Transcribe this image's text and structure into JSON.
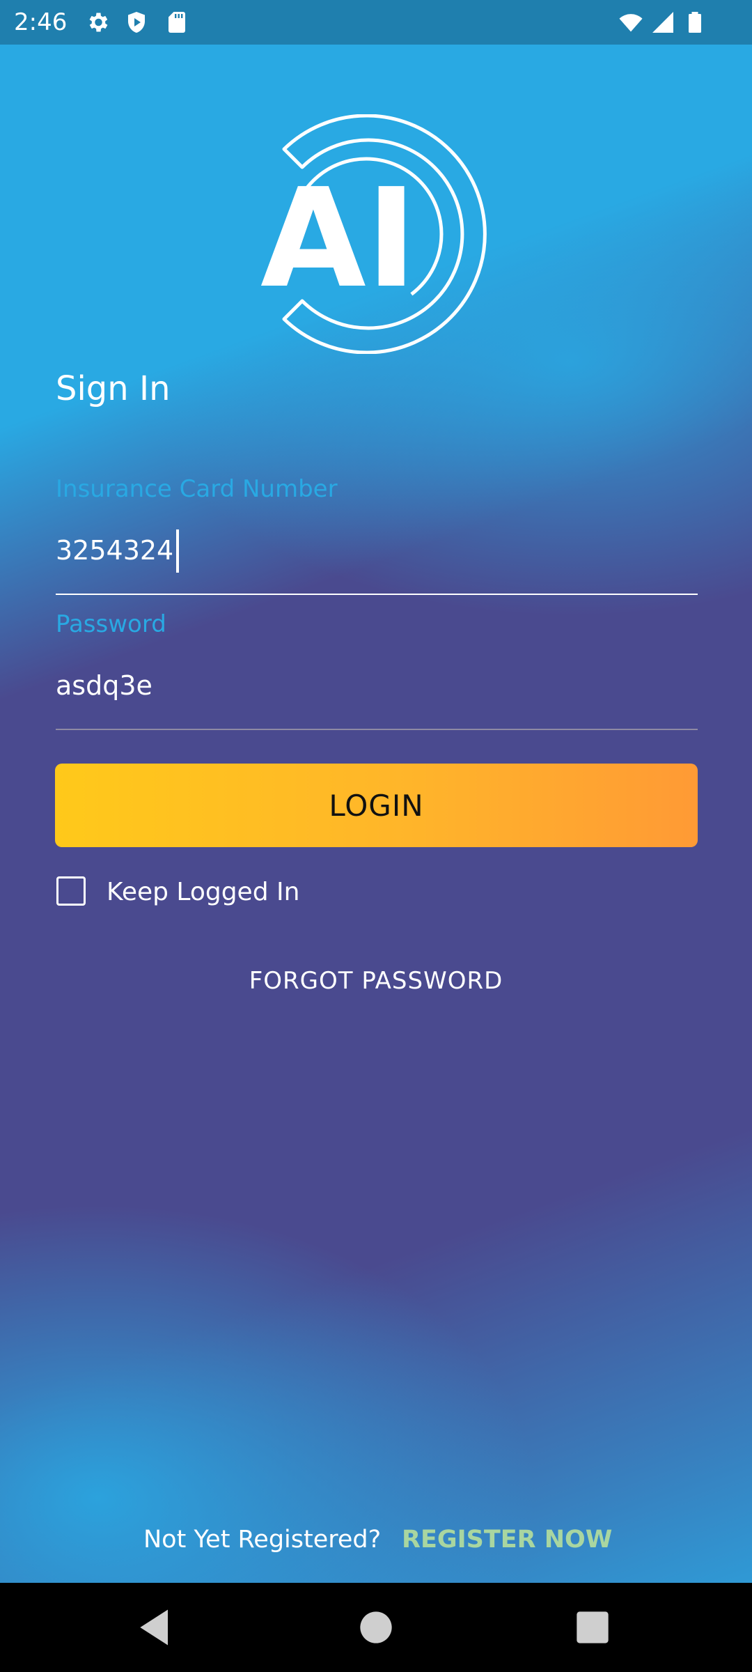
{
  "status_bar": {
    "time": "2:46",
    "left_icons": [
      "gear-icon",
      "shield-play-icon",
      "sd-card-icon"
    ],
    "right_icons": [
      "wifi-icon",
      "cell-signal-icon",
      "battery-icon"
    ]
  },
  "logo": {
    "text": "AI"
  },
  "page": {
    "title": "Sign In"
  },
  "form": {
    "card_label": "Insurance Card Number",
    "card_value": "3254324",
    "password_label": "Password",
    "password_value": "asdq3e",
    "login_label": "LOGIN",
    "keep_logged_in_label": "Keep Logged In",
    "keep_logged_in_checked": false,
    "forgot_label": "FORGOT PASSWORD"
  },
  "footer": {
    "not_registered": "Not Yet Registered?",
    "register_label": "REGISTER NOW"
  },
  "nav": {
    "icons": [
      "back-icon",
      "home-icon",
      "recents-icon"
    ]
  },
  "colors": {
    "accent_blue": "#29a9e3",
    "background_purple": "#4a4a8f",
    "button_start": "#ffc91a",
    "button_end": "#ff9a35",
    "register_green": "#a9d6a0"
  }
}
